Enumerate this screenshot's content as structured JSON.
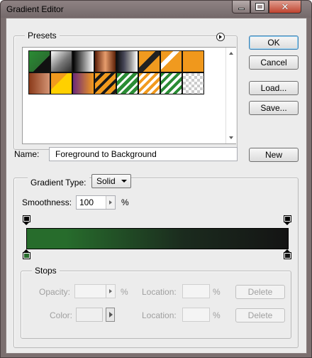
{
  "window": {
    "title": "Gradient Editor"
  },
  "presets": {
    "title": "Presets",
    "swatches": [
      {
        "name": "swatch-green-black",
        "bg": "linear-gradient(to bottom right, #2a8c34, #2a7030 60%, #111 60%)"
      },
      {
        "name": "swatch-green-transparent",
        "bg": "linear-gradient(135deg, #fff 0%, #777 55%, #2e2e2e 100%)"
      },
      {
        "name": "swatch-black-white",
        "bg": "linear-gradient(to right, #000, #fff)"
      },
      {
        "name": "swatch-copper",
        "bg": "linear-gradient(to right, #5a1d07, #e79d6d, #5c2107)"
      },
      {
        "name": "swatch-spectrum",
        "bg": "linear-gradient(to right, #111, #445, #999, #fff)"
      },
      {
        "name": "swatch-orange-stripe",
        "bg": "linear-gradient(135deg, #f09a1f 40%, #222 40%, #222 60%, #f09a1f 60%)"
      },
      {
        "name": "swatch-chrome",
        "bg": "linear-gradient(135deg, #f09a1f 30%, #fff 30%, #fff 45%, #f09a1f 45%)"
      },
      {
        "name": "swatch-orange",
        "bg": "#f0981c"
      },
      {
        "name": "swatch-copper-2",
        "bg": "linear-gradient(to right, #8a3a1a, #d49474)"
      },
      {
        "name": "swatch-orange-yellow",
        "bg": "linear-gradient(135deg, #f19a1e 40%, #ffd000 40%)"
      },
      {
        "name": "swatch-violet-orange",
        "bg": "linear-gradient(to right, #6b2a7a, #f39a1e)"
      },
      {
        "name": "swatch-orange-stripes-2",
        "bg": "repeating-linear-gradient(135deg, #f19a1e 0 6px, #1a1a1a 6px 10px)"
      },
      {
        "name": "swatch-green-stripes",
        "bg": "repeating-linear-gradient(135deg, #2a8c34 0 5px, #fff 5px 8px)"
      },
      {
        "name": "swatch-transparent-rainbow",
        "bg": "repeating-linear-gradient(135deg, #f19a1e 0 4px, #ffffff 4px 8px)"
      },
      {
        "name": "swatch-transparent-stripes",
        "bg": "repeating-linear-gradient(135deg, #2a8c34 0 4px, #ffffff 4px 8px)"
      },
      {
        "name": "swatch-neutral",
        "bg": "repeating-conic-gradient(#ccc 0% 25%, #fff 0% 50%) 0 0/8px 8px"
      }
    ]
  },
  "buttons": {
    "ok": "OK",
    "cancel": "Cancel",
    "load": "Load...",
    "save": "Save...",
    "new": "New",
    "delete_opacity": "Delete",
    "delete_color": "Delete"
  },
  "name_field": {
    "label": "Name:",
    "value": "Foreground to Background"
  },
  "gradient_type": {
    "label": "Gradient Type:",
    "value": "Solid"
  },
  "smoothness": {
    "label": "Smoothness:",
    "value": "100",
    "unit": "%"
  },
  "stops": {
    "title": "Stops",
    "opacity_label": "Opacity:",
    "opacity_unit": "%",
    "location_label_1": "Location:",
    "location_unit_1": "%",
    "color_label": "Color:",
    "location_label_2": "Location:",
    "location_unit_2": "%"
  },
  "gradient": {
    "start_color": "#276c2c",
    "end_color": "#141414"
  }
}
